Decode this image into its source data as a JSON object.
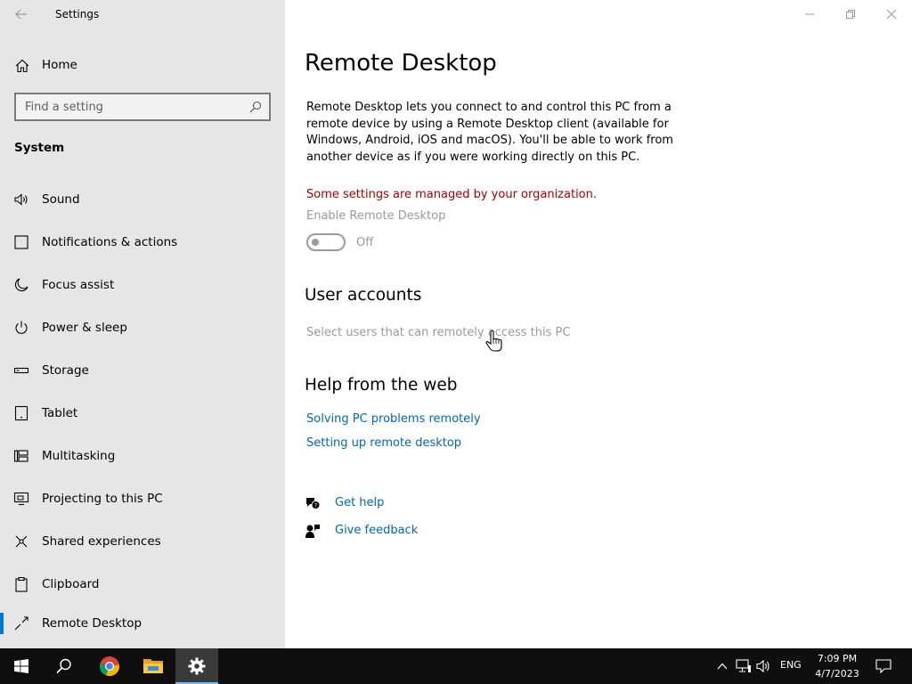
{
  "window": {
    "app_title": "Settings",
    "controls": [
      "minimize",
      "restore",
      "close"
    ]
  },
  "sidebar": {
    "home_label": "Home",
    "search": {
      "placeholder": "Find a setting"
    },
    "section_title": "System",
    "items": [
      {
        "label": "Sound",
        "icon": "speaker-icon"
      },
      {
        "label": "Notifications & actions",
        "icon": "notification-icon"
      },
      {
        "label": "Focus assist",
        "icon": "moon-icon"
      },
      {
        "label": "Power & sleep",
        "icon": "power-icon"
      },
      {
        "label": "Storage",
        "icon": "storage-icon"
      },
      {
        "label": "Tablet",
        "icon": "tablet-icon"
      },
      {
        "label": "Multitasking",
        "icon": "multitasking-icon"
      },
      {
        "label": "Projecting to this PC",
        "icon": "projecting-icon"
      },
      {
        "label": "Shared experiences",
        "icon": "shared-icon"
      },
      {
        "label": "Clipboard",
        "icon": "clipboard-icon"
      },
      {
        "label": "Remote Desktop",
        "icon": "remote-desktop-icon",
        "selected": true
      }
    ]
  },
  "main": {
    "title": "Remote Desktop",
    "description": "Remote Desktop lets you connect to and control this PC from a remote device by using a Remote Desktop client (available for Windows, Android, iOS and macOS). You'll be able to work from another device as if you were working directly on this PC.",
    "managed_notice": "Some settings are managed by your organization.",
    "enable_label": "Enable Remote Desktop",
    "toggle_state": "Off",
    "user_accounts_title": "User accounts",
    "user_accounts_link": "Select users that can remotely access this PC",
    "help_title": "Help from the web",
    "help_links": [
      "Solving PC problems remotely",
      "Setting up remote desktop"
    ],
    "get_help": "Get help",
    "give_feedback": "Give feedback"
  },
  "taskbar": {
    "apps": [
      "start-icon",
      "search-icon",
      "chrome-icon",
      "file-explorer-icon",
      "settings-icon"
    ],
    "active_app": "settings-icon",
    "language": "ENG",
    "time": "7:09 PM",
    "date": "4/7/2023"
  },
  "colors": {
    "accent": "#0078d4",
    "link": "#0067b8",
    "warning": "#a80000",
    "sidebar_bg": "#e6e6e6",
    "taskbar_bg": "#0f0f0f"
  }
}
